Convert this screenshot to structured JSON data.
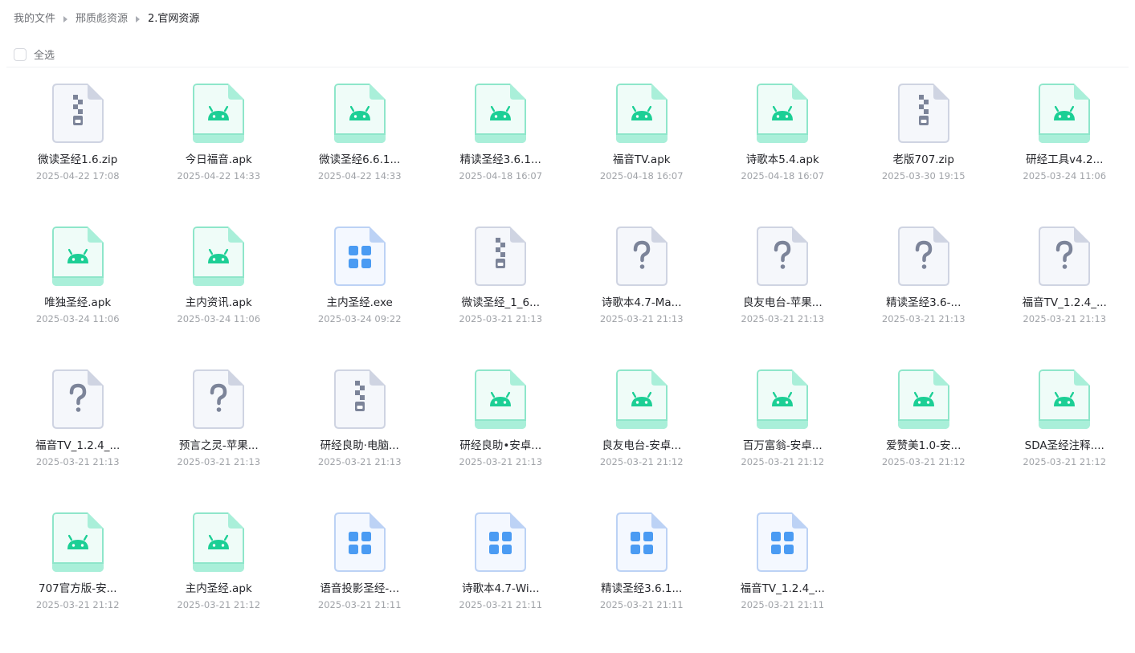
{
  "breadcrumb": [
    "我的文件",
    "邢质彪资源",
    "2.官网资源"
  ],
  "toolbar": {
    "select_all": "全选"
  },
  "colors": {
    "apk_fill": "#effcf8",
    "apk_stroke": "#8ee6ca",
    "apk_band": "#a9efd9",
    "android_green": "#1ccf95",
    "zip_fill": "#f5f7fb",
    "zip_stroke": "#cfd4e2",
    "zip_mark": "#7c8499",
    "unknown_fill": "#f5f7fb",
    "unknown_stroke": "#cfd4e2",
    "unknown_mark": "#7c8499",
    "exe_fill": "#f4f8ff",
    "exe_stroke": "#bcd2f5",
    "exe_mark": "#4a9bf3"
  },
  "files": [
    {
      "name": "微读圣经1.6.zip",
      "date": "2025-04-22 17:08",
      "icon": "zip-icon"
    },
    {
      "name": "今日福音.apk",
      "date": "2025-04-22 14:33",
      "icon": "android-icon"
    },
    {
      "name": "微读圣经6.6.1...",
      "date": "2025-04-22 14:33",
      "icon": "android-icon"
    },
    {
      "name": "精读圣经3.6.1...",
      "date": "2025-04-18 16:07",
      "icon": "android-icon"
    },
    {
      "name": "福音TV.apk",
      "date": "2025-04-18 16:07",
      "icon": "android-icon"
    },
    {
      "name": "诗歌本5.4.apk",
      "date": "2025-04-18 16:07",
      "icon": "android-icon"
    },
    {
      "name": "老版707.zip",
      "date": "2025-03-30 19:15",
      "icon": "zip-icon"
    },
    {
      "name": "研经工具v4.2...",
      "date": "2025-03-24 11:06",
      "icon": "android-icon"
    },
    {
      "name": "唯独圣经.apk",
      "date": "2025-03-24 11:06",
      "icon": "android-icon"
    },
    {
      "name": "主内资讯.apk",
      "date": "2025-03-24 11:06",
      "icon": "android-icon"
    },
    {
      "name": "主内圣经.exe",
      "date": "2025-03-24 09:22",
      "icon": "windows-app-icon"
    },
    {
      "name": "微读圣经_1_6...",
      "date": "2025-03-21 21:13",
      "icon": "zip-icon"
    },
    {
      "name": "诗歌本4.7-Ma...",
      "date": "2025-03-21 21:13",
      "icon": "unknown-file-icon"
    },
    {
      "name": "良友电台-苹果...",
      "date": "2025-03-21 21:13",
      "icon": "unknown-file-icon"
    },
    {
      "name": "精读圣经3.6-...",
      "date": "2025-03-21 21:13",
      "icon": "unknown-file-icon"
    },
    {
      "name": "福音TV_1.2.4_...",
      "date": "2025-03-21 21:13",
      "icon": "unknown-file-icon"
    },
    {
      "name": "福音TV_1.2.4_...",
      "date": "2025-03-21 21:13",
      "icon": "unknown-file-icon"
    },
    {
      "name": "预言之灵-苹果...",
      "date": "2025-03-21 21:13",
      "icon": "unknown-file-icon"
    },
    {
      "name": "研经良助·电脑...",
      "date": "2025-03-21 21:13",
      "icon": "zip-icon"
    },
    {
      "name": "研经良助•安卓...",
      "date": "2025-03-21 21:13",
      "icon": "android-icon"
    },
    {
      "name": "良友电台-安卓...",
      "date": "2025-03-21 21:12",
      "icon": "android-icon"
    },
    {
      "name": "百万富翁-安卓...",
      "date": "2025-03-21 21:12",
      "icon": "android-icon"
    },
    {
      "name": "爱赞美1.0-安...",
      "date": "2025-03-21 21:12",
      "icon": "android-icon"
    },
    {
      "name": "SDA圣经注释....",
      "date": "2025-03-21 21:12",
      "icon": "android-icon"
    },
    {
      "name": "707官方版-安...",
      "date": "2025-03-21 21:12",
      "icon": "android-icon"
    },
    {
      "name": "主内圣经.apk",
      "date": "2025-03-21 21:12",
      "icon": "android-icon"
    },
    {
      "name": "语音投影圣经-...",
      "date": "2025-03-21 21:11",
      "icon": "windows-app-icon"
    },
    {
      "name": "诗歌本4.7-Wi...",
      "date": "2025-03-21 21:11",
      "icon": "windows-app-icon"
    },
    {
      "name": "精读圣经3.6.1...",
      "date": "2025-03-21 21:11",
      "icon": "windows-app-icon"
    },
    {
      "name": "福音TV_1.2.4_...",
      "date": "2025-03-21 21:11",
      "icon": "windows-app-icon"
    }
  ]
}
